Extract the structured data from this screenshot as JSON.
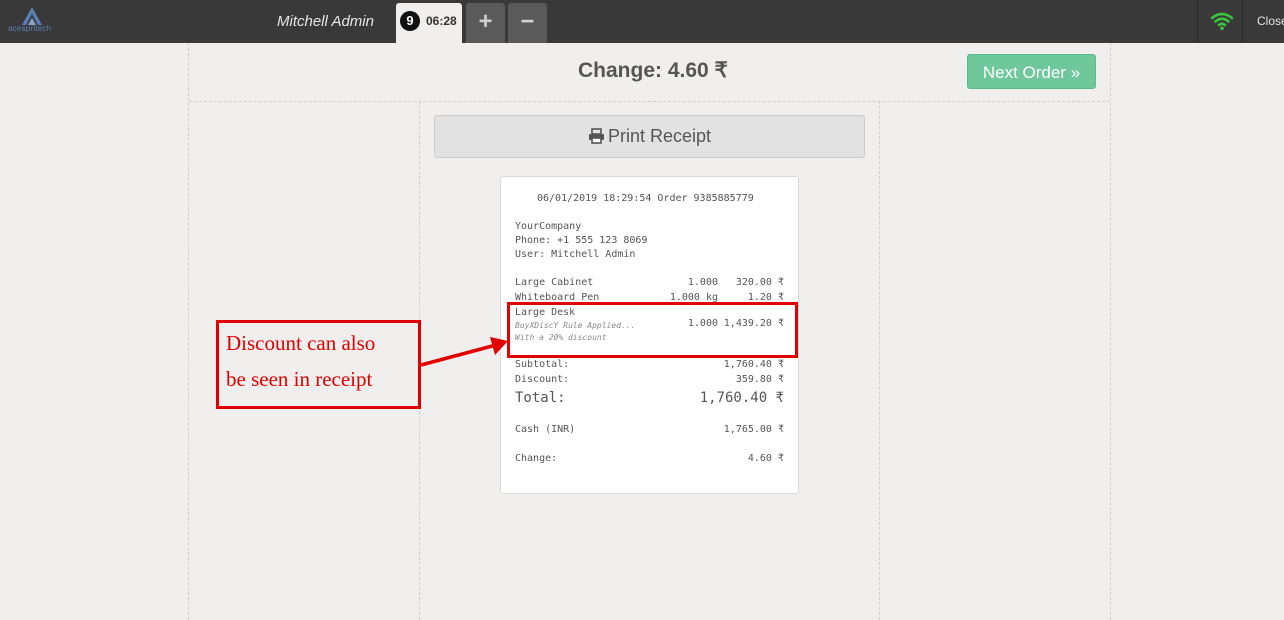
{
  "topbar": {
    "logo_text": "acespritech",
    "user_name": "Mitchell Admin",
    "order_number": "9",
    "order_time": "06:28",
    "add_label": "+",
    "remove_label": "−",
    "close_label": "Close",
    "wifi_color": "#3cc43c"
  },
  "screen": {
    "change_title": "Change: 4.60 ₹",
    "next_order_label": "Next Order »",
    "print_receipt_label": "Print Receipt"
  },
  "receipt": {
    "header": "06/01/2019 18:29:54 Order 9385885779",
    "company": "YourCompany",
    "phone": "Phone: +1 555 123 8069",
    "user": "User: Mitchell Admin",
    "lines": [
      {
        "name": "Large Cabinet",
        "qty": "1.000",
        "price": "320.00 ₹"
      },
      {
        "name": "Whiteboard Pen",
        "qty": "1.000 kg",
        "price": "1.20 ₹"
      },
      {
        "name": "Large Desk",
        "qty": "1.000",
        "price": "1,439.20 ₹",
        "note1": "BuyXDiscY Rule Applied...",
        "note2": "With a 20% discount"
      }
    ],
    "subtotal_label": "Subtotal:",
    "subtotal_value": "1,760.40 ₹",
    "discount_label": "Discount:",
    "discount_value": "359.80 ₹",
    "total_label": "Total:",
    "total_value": "1,760.40 ₹",
    "cash_label": "Cash (INR)",
    "cash_value": "1,765.00 ₹",
    "change_label": "Change:",
    "change_value": "4.60 ₹"
  },
  "annotation": {
    "line1": "Discount can also",
    "line2": "be seen in receipt",
    "color": "#e00000"
  }
}
